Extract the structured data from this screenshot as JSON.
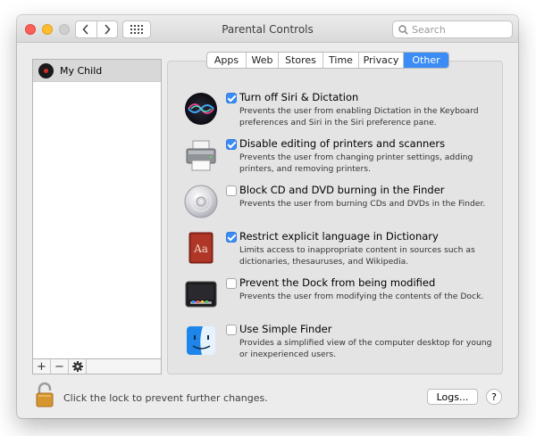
{
  "window": {
    "title": "Parental Controls"
  },
  "search": {
    "placeholder": "Search"
  },
  "users": [
    {
      "name": "My Child"
    }
  ],
  "list_controls": {
    "add": "+",
    "remove": "−"
  },
  "tabs": [
    {
      "label": "Apps",
      "selected": false
    },
    {
      "label": "Web",
      "selected": false
    },
    {
      "label": "Stores",
      "selected": false
    },
    {
      "label": "Time",
      "selected": false
    },
    {
      "label": "Privacy",
      "selected": false
    },
    {
      "label": "Other",
      "selected": true
    }
  ],
  "options": [
    {
      "icon": "siri-icon",
      "checked": true,
      "title": "Turn off Siri & Dictation",
      "description": "Prevents the user from enabling Dictation in the Keyboard preferences and Siri in the Siri preference pane."
    },
    {
      "icon": "printer-icon",
      "checked": true,
      "title": "Disable editing of printers and scanners",
      "description": "Prevents the user from changing printer settings, adding printers, and removing printers."
    },
    {
      "icon": "cd-icon",
      "checked": false,
      "title": "Block CD and DVD burning in the Finder",
      "description": "Prevents the user from burning CDs and DVDs in the Finder."
    },
    {
      "icon": "dictionary-icon",
      "checked": true,
      "title": "Restrict explicit language in Dictionary",
      "description": "Limits access to inappropriate content in sources such as dictionaries, thesauruses, and Wikipedia."
    },
    {
      "icon": "dock-icon",
      "checked": false,
      "title": "Prevent the Dock from being modified",
      "description": "Prevents the user from modifying the contents of the Dock."
    },
    {
      "icon": "finder-icon",
      "checked": false,
      "title": "Use Simple Finder",
      "description": "Provides a simplified view of the computer desktop for young or inexperienced users."
    }
  ],
  "footer": {
    "lock_text": "Click the lock to prevent further changes.",
    "logs_label": "Logs...",
    "help_label": "?"
  },
  "colors": {
    "accent": "#3b8cf5"
  }
}
